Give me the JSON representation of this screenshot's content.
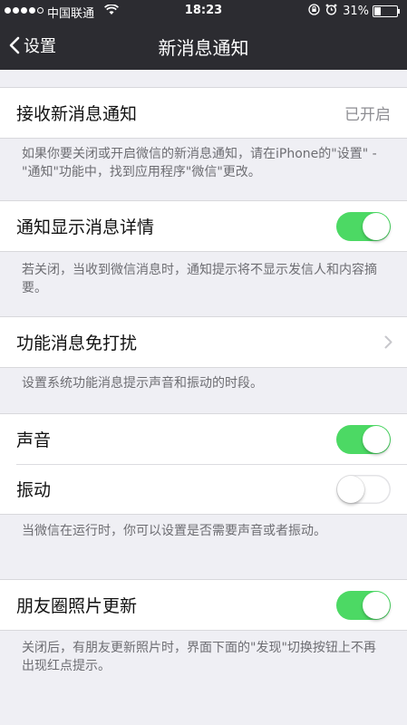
{
  "status_bar": {
    "carrier": "中国联通",
    "time": "18:23",
    "battery": "31%",
    "battery_level": 0.31,
    "signal_bars_filled": 4,
    "signal_bars_total": 5
  },
  "nav": {
    "back_label": "设置",
    "title": "新消息通知"
  },
  "sections": {
    "receive": {
      "label": "接收新消息通知",
      "value": "已开启",
      "note": "如果你要关闭或开启微信的新消息通知，请在iPhone的\"设置\" - \"通知\"功能中，找到应用程序\"微信\"更改。"
    },
    "details": {
      "label": "通知显示消息详情",
      "on": true,
      "note": "若关闭，当收到微信消息时，通知提示将不显示发信人和内容摘要。"
    },
    "dnd": {
      "label": "功能消息免打扰",
      "note": "设置系统功能消息提示声音和振动的时段。"
    },
    "sound": {
      "label": "声音",
      "on": true
    },
    "vibrate": {
      "label": "振动",
      "on": false,
      "note": "当微信在运行时，你可以设置是否需要声音或者振动。"
    },
    "moments": {
      "label": "朋友圈照片更新",
      "on": true,
      "note": "关闭后，有朋友更新照片时，界面下面的\"发现\"切换按钮上不再出现红点提示。"
    }
  },
  "colors": {
    "toggle_on": "#4cd964",
    "nav_background": "#2c2c31",
    "page_background": "#efeff4"
  }
}
